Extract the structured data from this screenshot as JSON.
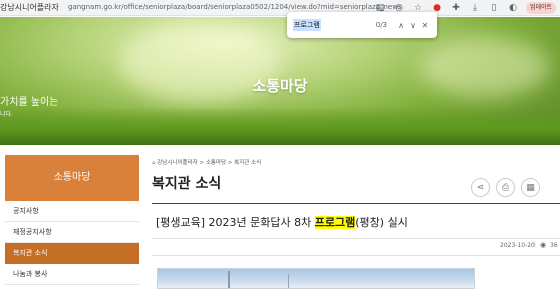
{
  "browser": {
    "site_identity": "강남시니어플라자",
    "url": "gangnam.go.kr/office/seniorplaza/board/seniorplaza0502/1204/view.do?mid=seniorplaza_news",
    "profile_label": "업데이트"
  },
  "find": {
    "query": "프로그램",
    "count": "0/3"
  },
  "hero": {
    "title": "소통마당",
    "slogan": "가치를 높이는",
    "sub": "니다."
  },
  "sidebar": {
    "title": "소통마당",
    "items": [
      {
        "label": "공지사항"
      },
      {
        "label": "재정공지사항"
      },
      {
        "label": "복지관 소식"
      },
      {
        "label": "나눔과 봉사"
      }
    ]
  },
  "breadcrumb": {
    "home_icon": "home-icon",
    "text": "강남시니어플라자 > 소통마당 > 복지관 소식"
  },
  "main": {
    "title": "복지관 소식",
    "post": {
      "prefix": "[평생교육] 2023년 문화답사 8차 ",
      "highlight": "프로그램",
      "suffix": "(평창) 실시",
      "date": "2023-10-20",
      "views": "36"
    }
  },
  "colors": {
    "sidebar_head": "#d9803b",
    "sidebar_active": "#c46e28",
    "find_highlight": "#ffff00"
  }
}
